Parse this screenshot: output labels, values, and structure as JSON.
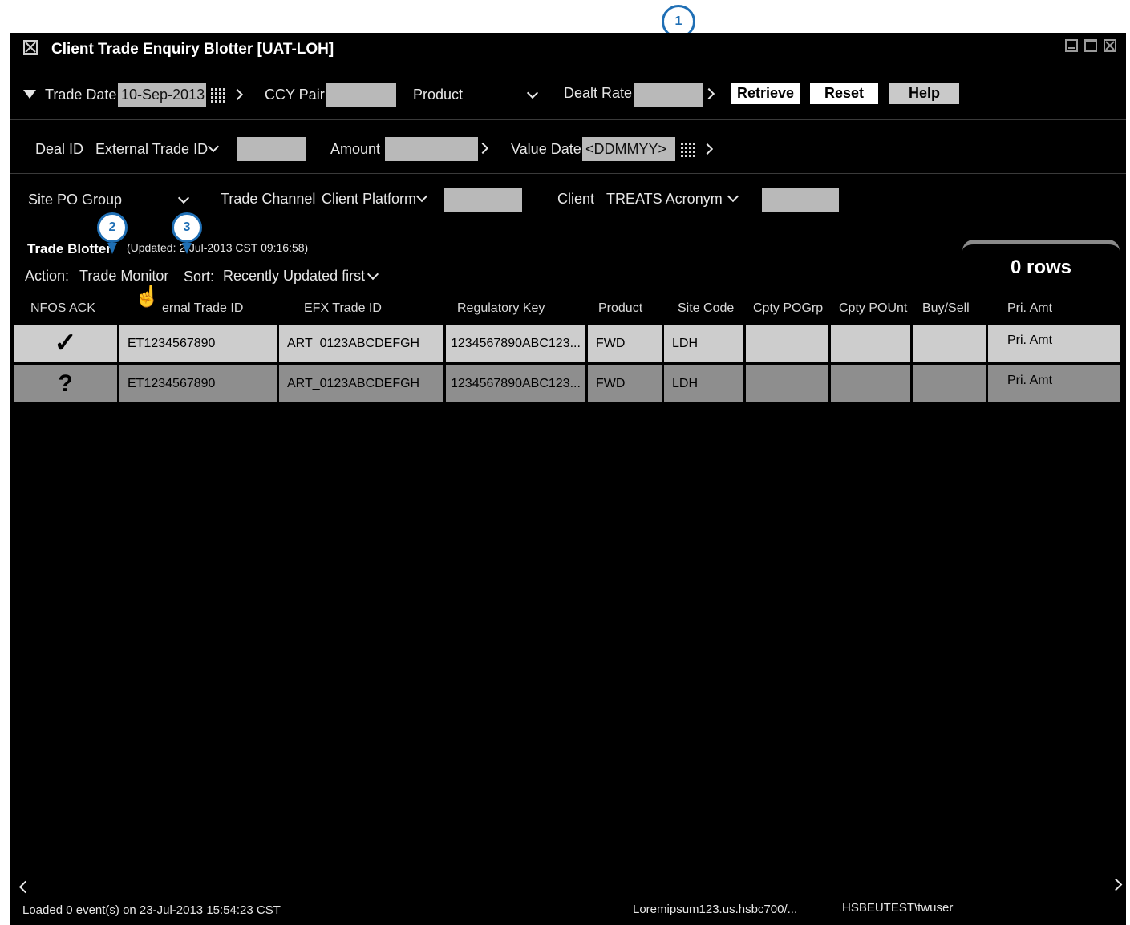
{
  "window": {
    "title": "Client Trade Enquiry Blotter [UAT-LOH]"
  },
  "filters": {
    "trade_date_label": "Trade Date",
    "trade_date_value": "10-Sep-2013",
    "ccy_pair_label": "CCY Pair",
    "ccy_pair_value": "",
    "product_label": "Product",
    "dealt_rate_label": "Dealt Rate",
    "dealt_rate_value": "",
    "deal_id_label": "Deal ID",
    "external_trade_id_label": "External Trade ID",
    "external_trade_id_value": "",
    "amount_label": "Amount",
    "amount_value": "",
    "value_date_label": "Value Date",
    "value_date_placeholder": "<DDMMYY>",
    "site_po_group_label": "Site PO Group",
    "trade_channel_label": "Trade Channel",
    "client_platform_label": "Client Platform",
    "client_platform_value": "",
    "client_label": "Client",
    "treats_acronym_label": "TREATS Acronym",
    "treats_acronym_value": ""
  },
  "buttons": {
    "retrieve": "Retrieve",
    "reset": "Reset",
    "help": "Help"
  },
  "blotter": {
    "title": "Trade Blotter",
    "updated": "(Updated: 2",
    "updated_rest": "-Jul-2013 CST 09:16:58)",
    "action_label": "Action:",
    "action_value": "Trade Monitor",
    "sort_label": "Sort:",
    "sort_value": "Recently Updated first",
    "row_count": "0 rows"
  },
  "table": {
    "columns": [
      "NFOS ACK",
      "ernal Trade ID",
      "EFX Trade ID",
      "Regulatory Key",
      "Product",
      "Site Code",
      "Cpty POGrp",
      "Cpty POUnt",
      "Buy/Sell",
      "Pri. Amt"
    ],
    "rows": [
      {
        "ack": "✓",
        "ext_id": "ET1234567890",
        "efx_id": "ART_0123ABCDEFGH",
        "reg_key": "1234567890ABC123...",
        "product": "FWD",
        "site": "LDH",
        "pogrp": "",
        "pount": "",
        "buysell": "",
        "pri_amt": "Pri. Amt"
      },
      {
        "ack": "?",
        "ext_id": "ET1234567890",
        "efx_id": "ART_0123ABCDEFGH",
        "reg_key": "1234567890ABC123...",
        "product": "FWD",
        "site": "LDH",
        "pogrp": "",
        "pount": "",
        "buysell": "",
        "pri_amt": "Pri. Amt"
      }
    ]
  },
  "status": {
    "loaded": "Loaded 0 event(s) on 23-Jul-2013 15:54:23 CST",
    "server": "Loremipsum123.us.hsbc700/...",
    "user": "HSBEUTEST\\twuser"
  },
  "callouts": [
    "1",
    "2",
    "3"
  ],
  "colors": {
    "background": "#000000",
    "row_light": "#cdcdcd",
    "row_dark": "#8e8e8e",
    "callout": "#1f6fb5"
  }
}
